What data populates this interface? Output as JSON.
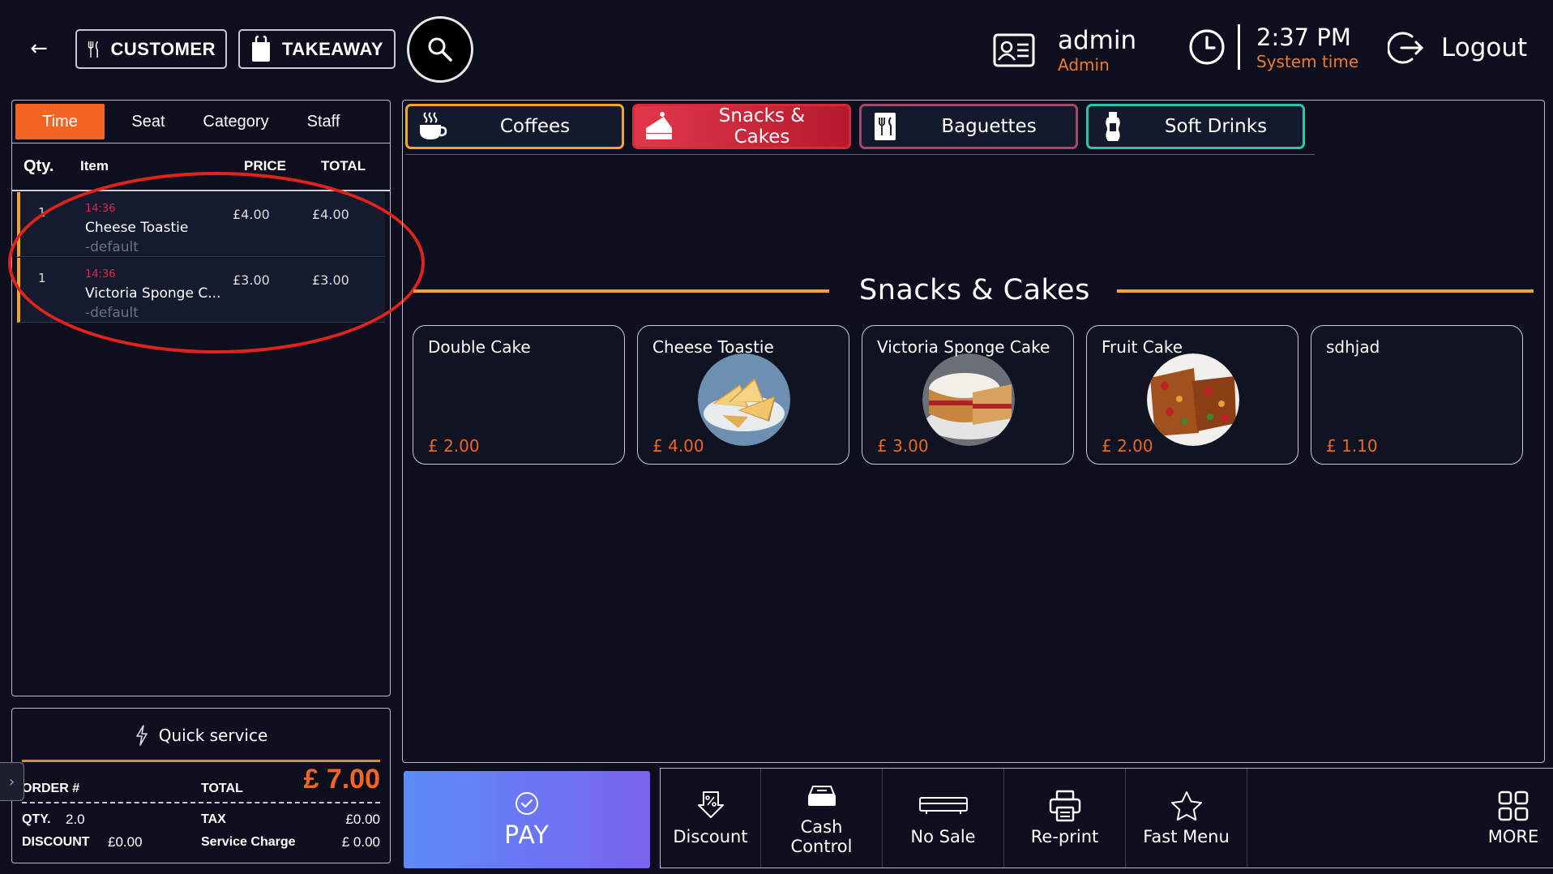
{
  "header": {
    "back_icon": "arrow-left-icon",
    "customer_label": "CUSTOMER",
    "takeaway_label": "TAKEAWAY",
    "user_name": "admin",
    "user_role": "Admin",
    "time": "2:37 PM",
    "time_label": "System time",
    "logout_label": "Logout"
  },
  "order_tabs": [
    {
      "label": "Time",
      "active": true
    },
    {
      "label": "Seat",
      "active": false
    },
    {
      "label": "Category",
      "active": false
    },
    {
      "label": "Staff",
      "active": false
    }
  ],
  "order_columns": {
    "qty": "Qty.",
    "item": "Item",
    "price": "PRICE",
    "total": "TOTAL"
  },
  "order_items": [
    {
      "qty": "1",
      "time": "14:36",
      "name": "Cheese Toastie",
      "modifier": "-default",
      "price": "£4.00",
      "total": "£4.00"
    },
    {
      "qty": "1",
      "time": "14:36",
      "name": "Victoria Sponge C...",
      "modifier": "-default",
      "price": "£3.00",
      "total": "£3.00"
    }
  ],
  "summary": {
    "mode_label": "Quick service",
    "order_label": "ORDER #",
    "total_label": "TOTAL",
    "total_amount": "£ 7.00",
    "qty_label": "QTY.",
    "qty_value": "2.0",
    "tax_label": "TAX",
    "tax_value": "£0.00",
    "discount_label": "DISCOUNT",
    "discount_value": "£0.00",
    "service_label": "Service Charge",
    "service_value": "£ 0.00"
  },
  "categories": [
    {
      "label": "Coffees",
      "color": "#f5a623",
      "icon": "coffee-icon",
      "active": false
    },
    {
      "label": "Snacks &\nCakes",
      "color": "#d42a3c",
      "icon": "cake-icon",
      "active": true
    },
    {
      "label": "Baguettes",
      "color": "#8a4fb0",
      "icon": "menu-card-icon",
      "active": false
    },
    {
      "label": "Soft Drinks",
      "color": "#2ec4a6",
      "icon": "drink-bottle-icon",
      "active": false
    }
  ],
  "section_title": "Snacks & Cakes",
  "products": [
    {
      "name": "Double Cake",
      "price": "£ 2.00",
      "image": "none"
    },
    {
      "name": "Cheese Toastie",
      "price": "£ 4.00",
      "image": "toastie"
    },
    {
      "name": "Victoria Sponge Cake",
      "price": "£ 3.00",
      "image": "sponge"
    },
    {
      "name": "Fruit Cake",
      "price": "£ 2.00",
      "image": "fruitcake"
    },
    {
      "name": "sdhjad",
      "price": "£ 1.10",
      "image": "none"
    }
  ],
  "actions": {
    "pay_label": "PAY",
    "discount_label": "Discount",
    "cash_control_label": "Cash\nControl",
    "no_sale_label": "No Sale",
    "reprint_label": "Re-print",
    "fast_menu_label": "Fast Menu",
    "more_label": "MORE"
  },
  "colors": {
    "background": "#0d0f1e",
    "accent_orange": "#f26522",
    "time_red": "#e0284a",
    "highlight_ring": "#e3231b"
  }
}
